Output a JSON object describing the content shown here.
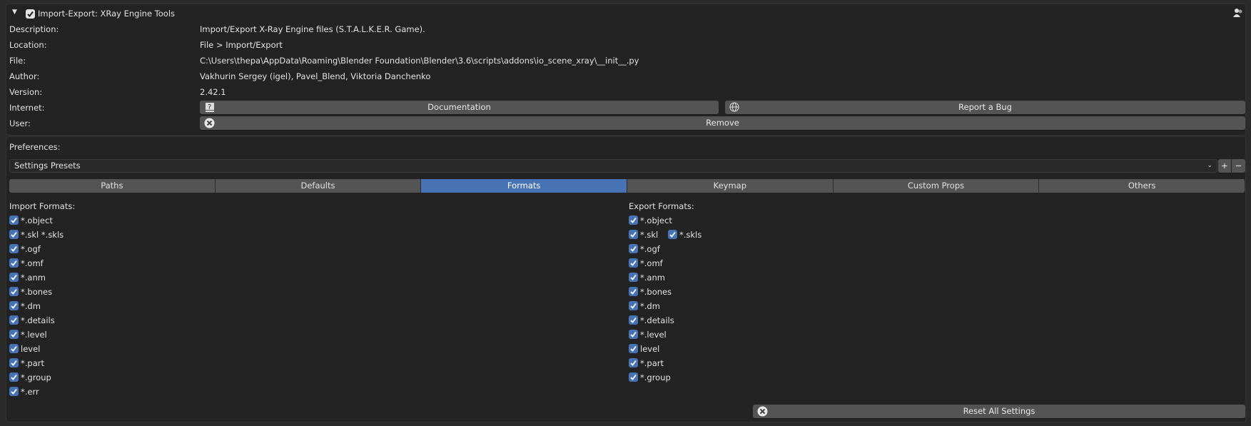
{
  "addon": {
    "title": "Import-Export: XRay Engine Tools",
    "enabled": true,
    "expanded": true
  },
  "info": [
    {
      "label": "Description:",
      "value": "Import/Export X-Ray Engine files (S.T.A.L.K.E.R. Game)."
    },
    {
      "label": "Location:",
      "value": "File > Import/Export"
    },
    {
      "label": "File:",
      "value": "C:\\Users\\thepa\\AppData\\Roaming\\Blender Foundation\\Blender\\3.6\\scripts\\addons\\io_scene_xray\\__init__.py"
    },
    {
      "label": "Author:",
      "value": "Vakhurin Sergey (igel), Pavel_Blend, Viktoria Danchenko"
    },
    {
      "label": "Version:",
      "value": "2.42.1"
    }
  ],
  "internet": {
    "label": "Internet:",
    "documentation": "Documentation",
    "report_bug": "Report a Bug"
  },
  "user": {
    "label": "User:",
    "remove": "Remove"
  },
  "preferences": {
    "label": "Preferences:",
    "presets": "Settings Presets"
  },
  "tabs": [
    "Paths",
    "Defaults",
    "Formats",
    "Keymap",
    "Custom Props",
    "Others"
  ],
  "active_tab": "Formats",
  "import": {
    "title": "Import Formats:",
    "items": [
      "*.object",
      "*.skl *.skls",
      "*.ogf",
      "*.omf",
      "*.anm",
      "*.bones",
      "*.dm",
      "*.details",
      "*.level",
      "level",
      "*.part",
      "*.group",
      "*.err"
    ]
  },
  "export": {
    "title": "Export Formats:",
    "items": [
      "*.object",
      "*.skl",
      "*.ogf",
      "*.omf",
      "*.anm",
      "*.bones",
      "*.dm",
      "*.details",
      "*.level",
      "level",
      "*.part",
      "*.group"
    ],
    "extra": "*.skls"
  },
  "reset": "Reset All Settings",
  "colors": {
    "accent": "#4772b3",
    "button": "#545454",
    "panel": "#232323"
  }
}
